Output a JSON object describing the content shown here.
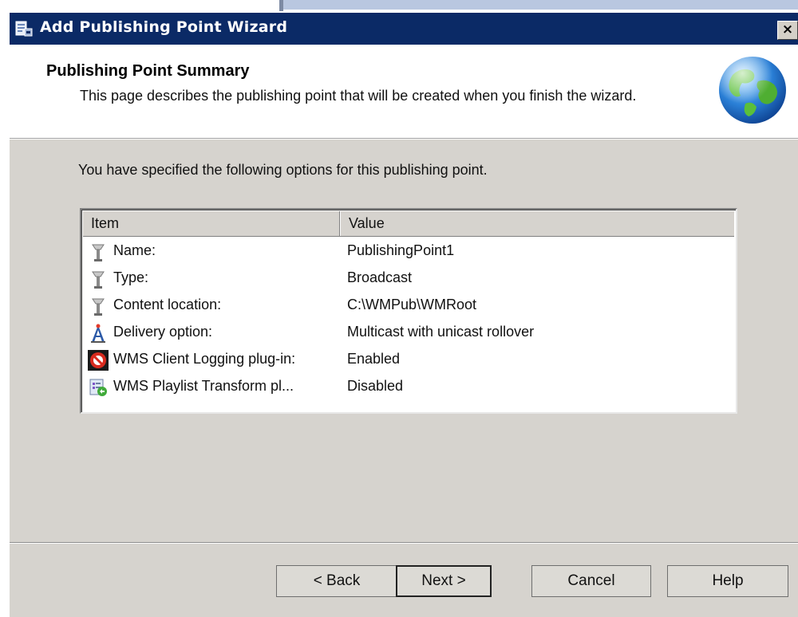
{
  "window": {
    "title": "Add Publishing Point Wizard",
    "close_label": "×"
  },
  "header": {
    "title": "Publishing Point Summary",
    "description": "This page describes the publishing point that will be created when you finish the wizard."
  },
  "body": {
    "intro": "You have specified the following options for this publishing point."
  },
  "table": {
    "columns": [
      "Item",
      "Value"
    ],
    "rows": [
      {
        "label": "Name:",
        "value": "PublishingPoint1",
        "icon": "pole-icon"
      },
      {
        "label": "Type:",
        "value": "Broadcast",
        "icon": "pole-icon"
      },
      {
        "label": "Content location:",
        "value": "C:\\WMPub\\WMRoot",
        "icon": "pole-icon"
      },
      {
        "label": "Delivery option:",
        "value": "Multicast with unicast rollover",
        "icon": "antenna-tower-icon"
      },
      {
        "label": "WMS Client Logging plug-in:",
        "value": "Enabled",
        "icon": "no-sign-icon"
      },
      {
        "label": "WMS Playlist Transform pl...",
        "value": "Disabled",
        "icon": "playlist-transform-icon"
      }
    ]
  },
  "buttons": {
    "back": "< Back",
    "next": "Next >",
    "cancel": "Cancel",
    "help": "Help"
  },
  "colors": {
    "titlebar": "#0b2a66",
    "dialog_face": "#d6d3ce",
    "header_bg": "#ffffff"
  }
}
